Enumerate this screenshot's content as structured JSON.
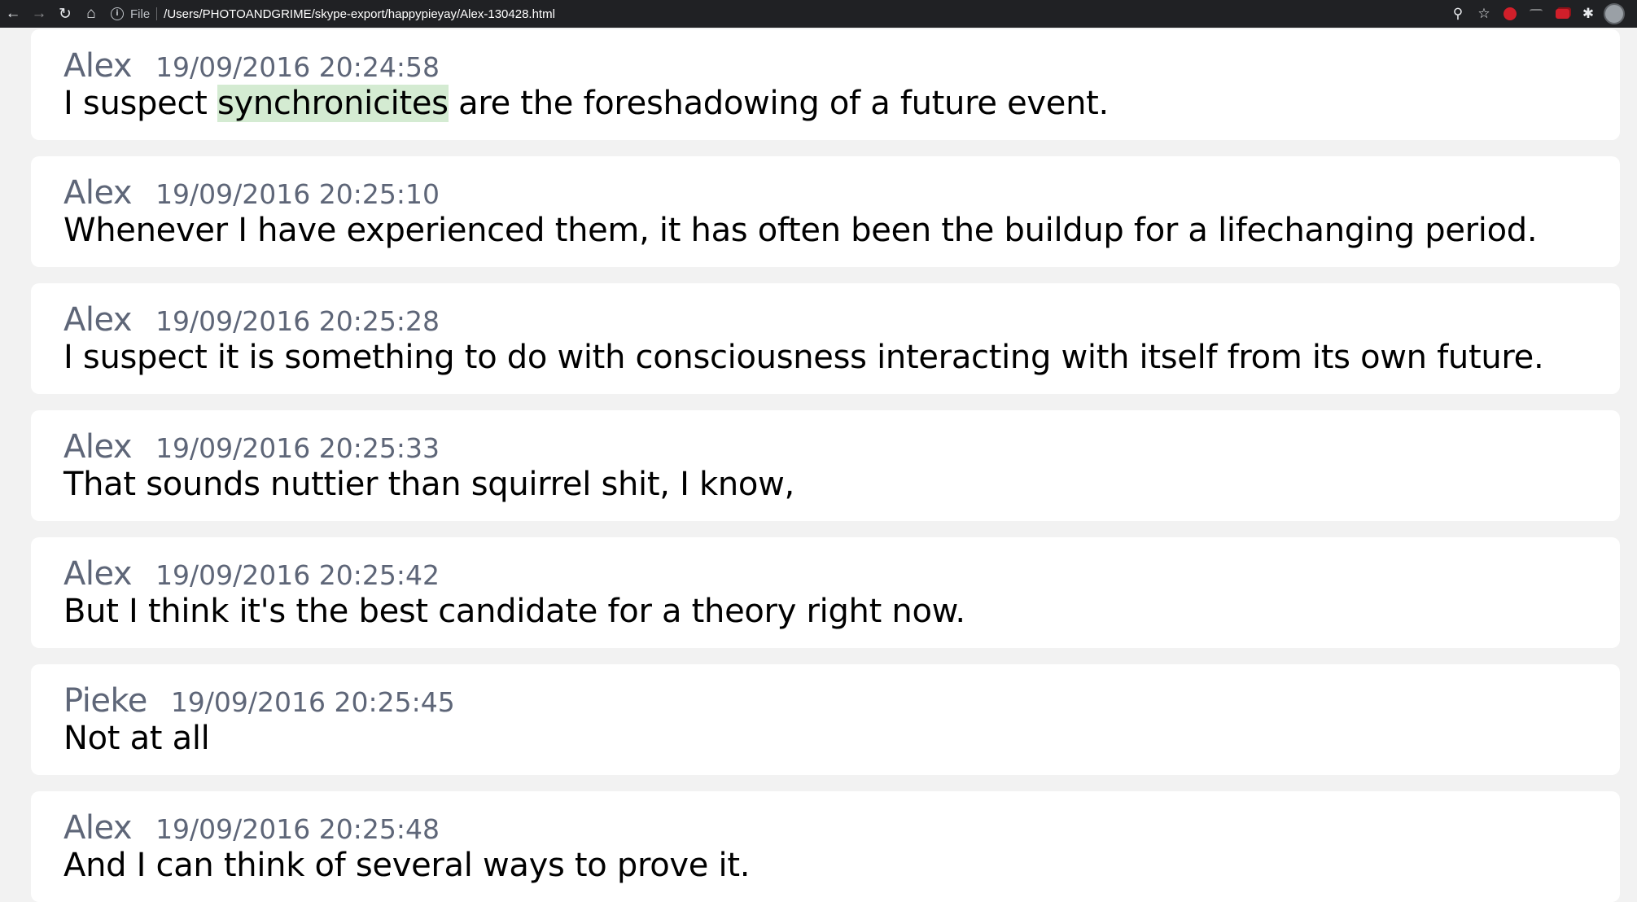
{
  "browser": {
    "scheme_label": "File",
    "url": "/Users/PHOTOANDGRIME/skype-export/happypieyay/Alex-130428.html"
  },
  "messages": [
    {
      "author": "Alex",
      "time": "19/09/2016 20:24:58",
      "text_before": "I suspect ",
      "highlight": "synchronicites",
      "text_after": " are the foreshadowing of a future event."
    },
    {
      "author": "Alex",
      "time": "19/09/2016 20:25:10",
      "text_before": "Whenever I have experienced them, it has often been the buildup for a lifechanging period.",
      "highlight": "",
      "text_after": ""
    },
    {
      "author": "Alex",
      "time": "19/09/2016 20:25:28",
      "text_before": "I suspect it is something to do with consciousness interacting with itself from its own future.",
      "highlight": "",
      "text_after": ""
    },
    {
      "author": "Alex",
      "time": "19/09/2016 20:25:33",
      "text_before": "That sounds nuttier than squirrel shit, I know,",
      "highlight": "",
      "text_after": ""
    },
    {
      "author": "Alex",
      "time": "19/09/2016 20:25:42",
      "text_before": "But I think it's the best candidate for a theory right now.",
      "highlight": "",
      "text_after": ""
    },
    {
      "author": "Pieke",
      "time": "19/09/2016 20:25:45",
      "text_before": "Not at all",
      "highlight": "",
      "text_after": ""
    },
    {
      "author": "Alex",
      "time": "19/09/2016 20:25:48",
      "text_before": "And I can think of several ways to prove it.",
      "highlight": "",
      "text_after": ""
    }
  ],
  "colors": {
    "highlight": "#d4ebd2",
    "meta_text": "#5e6678",
    "toolbar_bg": "#202124",
    "page_bg": "#f2f2f2"
  }
}
